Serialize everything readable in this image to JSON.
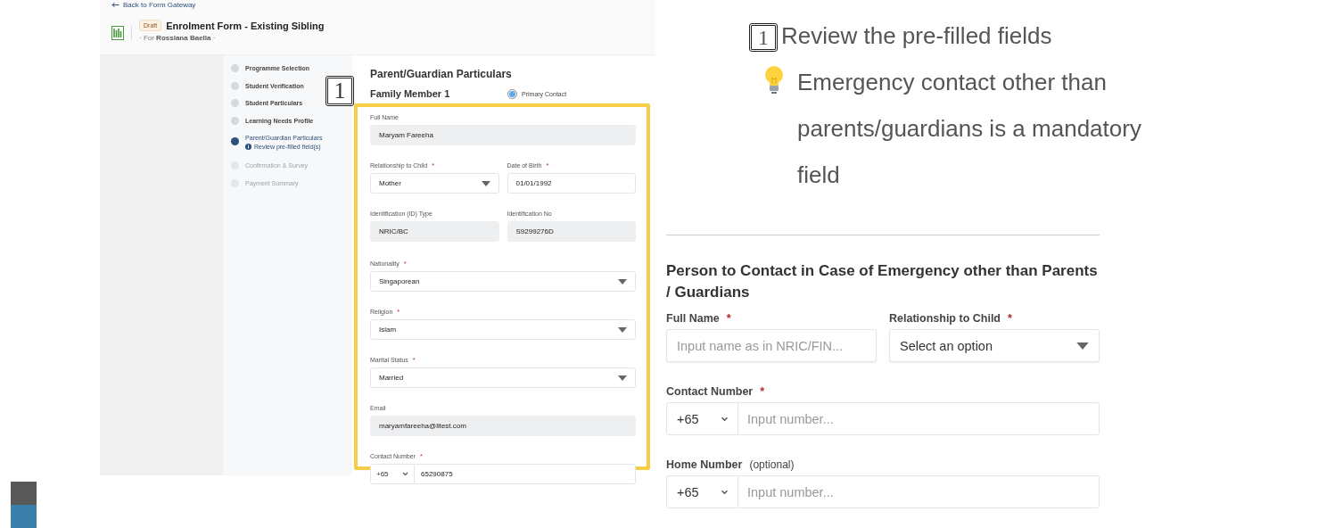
{
  "header": {
    "back_link": "Back to Form Gateway",
    "status_badge": "Draft",
    "title": "Enrolment Form - Existing Sibling",
    "subtitle": "· For **Rosslana Baella** ·"
  },
  "steps": [
    {
      "label": "Programme Selection",
      "current": false,
      "disabled": false
    },
    {
      "label": "Student Verification",
      "current": false,
      "disabled": false
    },
    {
      "label": "Student Particulars",
      "current": false,
      "disabled": false
    },
    {
      "label": "Learning Needs Profile",
      "current": false,
      "disabled": false
    },
    {
      "label": "Parent/Guardian Particulars",
      "current": true,
      "disabled": false,
      "note": "Review pre-filled field(s)"
    },
    {
      "label": "Confirmation & Survey",
      "current": false,
      "disabled": true
    },
    {
      "label": "Payment Summary",
      "current": false,
      "disabled": true
    }
  ],
  "left_callout": "1",
  "section_title": "Parent/Guardian Particulars",
  "member": {
    "title": "Family Member 1",
    "primary_contact": {
      "label": "Primary Contact",
      "selected": true
    }
  },
  "fields": [
    [
      {
        "kind": "text",
        "label": "Full Name",
        "value": "Maryam Fareeha",
        "prefilled": true
      }
    ],
    [
      {
        "kind": "select",
        "label": "Relationship to Child",
        "required_mark": "*",
        "value": "Mother"
      },
      {
        "kind": "text",
        "label": "Date of Birth",
        "required_mark": "*",
        "value": "01/01/1992",
        "prefilled": false
      }
    ],
    [
      {
        "kind": "text",
        "label": "Identification (ID) Type",
        "value": "NRIC/BC",
        "prefilled": true
      },
      {
        "kind": "text",
        "label": "Identification No",
        "value": "S9299276D",
        "prefilled": true
      }
    ],
    [
      {
        "kind": "select",
        "label": "Nationality",
        "required_mark": "*",
        "value": "Singaporean"
      }
    ],
    [
      {
        "kind": "select",
        "label": "Religion",
        "required_mark": "*",
        "value": "Islam"
      }
    ],
    [
      {
        "kind": "select",
        "label": "Marital Status",
        "required_mark": "*",
        "value": "Married"
      }
    ],
    [
      {
        "kind": "text",
        "label": "Email",
        "value": "maryamfareeha@lltest.com",
        "prefilled": true
      }
    ],
    [
      {
        "kind": "phone",
        "label": "Contact Number",
        "required_mark": "*",
        "country_code": "+65",
        "value": "65290875"
      }
    ]
  ],
  "tips": [
    {
      "kind": "step",
      "marker": "1",
      "text": "Review the pre-filled fields"
    },
    {
      "kind": "hint",
      "text": "Emergency contact other than parents/guardians is a mandatory field"
    }
  ],
  "emergency": {
    "title": "Person to Contact in Case of Emergency other than Parents / Guardians",
    "fields": [
      [
        {
          "kind": "text",
          "label": "Full Name",
          "required_mark": "*",
          "placeholder": "Input name as in NRIC/FIN..."
        },
        {
          "kind": "select",
          "label": "Relationship to Child",
          "required_mark": "*",
          "value": "Select an option"
        }
      ],
      [
        {
          "kind": "phone",
          "label": "Contact Number",
          "required_mark": "*",
          "country_code": "+65",
          "placeholder": "Input number..."
        }
      ],
      [
        {
          "kind": "phone",
          "label": "Home Number",
          "hint": "(optional)",
          "country_code": "+65",
          "placeholder": "Input number..."
        }
      ]
    ]
  }
}
